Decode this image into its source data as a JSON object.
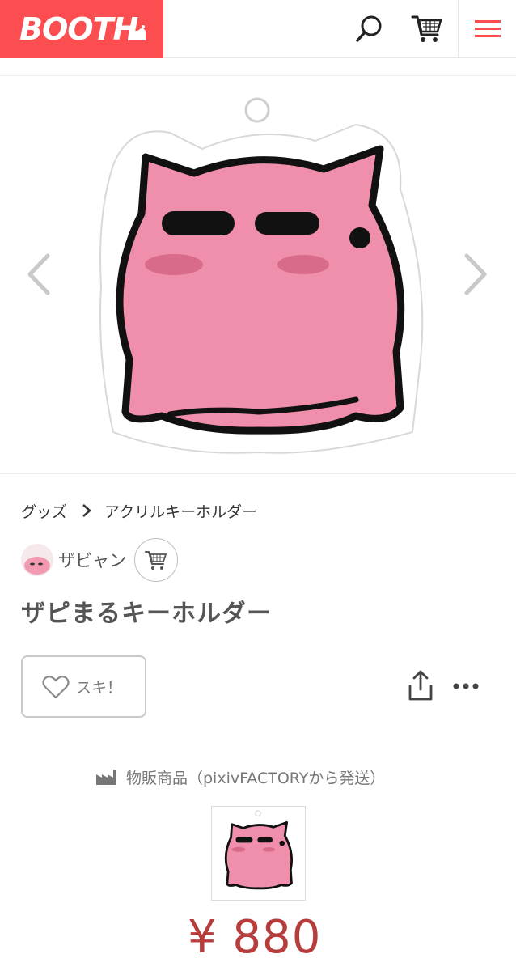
{
  "header": {
    "logo_text": "BOOTH",
    "brand_color": "#fc4d50",
    "icons": [
      "search-icon",
      "cart-icon",
      "menu-icon"
    ]
  },
  "hero": {
    "image_subject": "pink-blob-keychain",
    "icons": [
      "chevron-left-icon",
      "chevron-right-icon"
    ]
  },
  "breadcrumb": {
    "items": [
      "グッズ",
      "アクリルキーホルダー"
    ]
  },
  "shop": {
    "name": "ザビャン"
  },
  "product": {
    "title": "ザピまるキーホルダー",
    "like_label": "スキ！",
    "shipping_label": "物販商品（pixivFACTORYから発送）",
    "price": "¥ 880",
    "price_color": "#b73c3c"
  }
}
